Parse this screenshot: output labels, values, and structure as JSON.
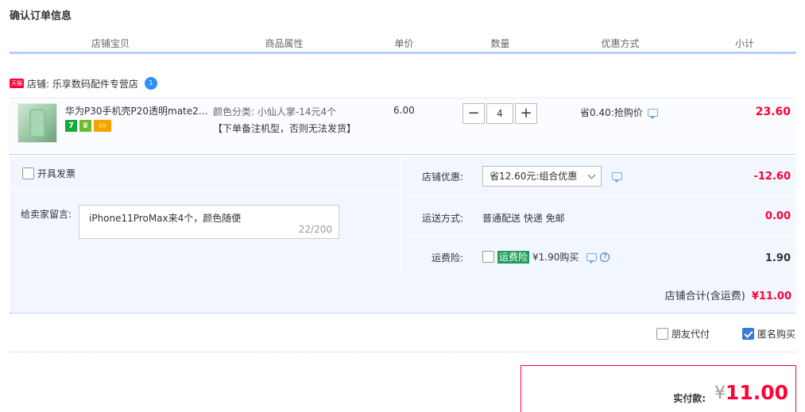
{
  "page": {
    "title": "确认订单信息"
  },
  "columns": [
    "店铺宝贝",
    "商品属性",
    "单价",
    "数量",
    "优惠方式",
    "小计"
  ],
  "shop": {
    "badge": "天猫",
    "label": "店铺: 乐享数码配件专营店",
    "chat_badge": "1"
  },
  "item": {
    "name": "华为P30手机壳P20透明mate2…",
    "attr_color": "颜色分类: 小仙人掌-14元4个",
    "attr_note": "【下单备注机型，否则无法发货】",
    "badges": [
      "7",
      "",
      ""
    ],
    "unit_price": "6.00",
    "qty_minus": "−",
    "qty": "4",
    "qty_plus": "+",
    "promo": "省0.40:抢购价",
    "subtotal": "23.60"
  },
  "invoice": {
    "label": "开具发票",
    "checked": false
  },
  "message": {
    "label": "给卖家留言:",
    "value": "iPhone11ProMax来4个，颜色随便",
    "count": "22/200"
  },
  "shop_discount": {
    "label": "店铺优惠:",
    "selected": "省12.60元:组合优惠",
    "amount": "-12.60"
  },
  "shipping": {
    "label": "运送方式:",
    "method": "普通配送 快递 免邮",
    "amount": "0.00"
  },
  "insurance": {
    "label": "运费险:",
    "tag": "运费险",
    "price": "¥1.90购买",
    "help": "?",
    "amount": "1.90"
  },
  "shop_total": {
    "label": "店铺合计(含运费)",
    "amount": "¥11.00"
  },
  "options": {
    "friend_pay": "朋友代付",
    "anonymous": "匿名购买",
    "anonymous_checked": true
  },
  "payment": {
    "label": "实付款:",
    "currency": "¥",
    "amount": "11.00"
  },
  "colors": {
    "accent_red": "#ff0036",
    "header_bar": "#b2d1ff",
    "panel_bg": "#f2f7ff",
    "link_blue": "#3a7bd5"
  }
}
